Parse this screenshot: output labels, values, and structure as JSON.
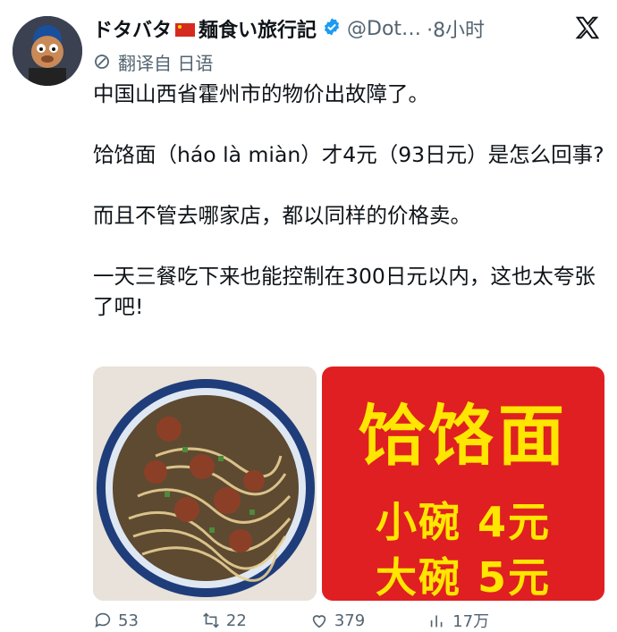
{
  "tweet": {
    "author_name": "ドタバタ",
    "author_name_suffix": "麺食い旅行記",
    "handle": "@Dot…",
    "separator": "·",
    "time": "8小时",
    "translate_label": "翻译自 日语",
    "paragraphs": [
      "中国山西省霍州市的物价出故障了。",
      "饸饹面（háo là miàn）才4元（93日元）是怎么回事?",
      "而且不管去哪家店，都以同样的价格卖。",
      "一天三餐吃下来也能控制在300日元以内，这也太夸张了吧!"
    ],
    "sign": {
      "title": "饸饹面",
      "small": "小碗 4元",
      "large": "大碗 5元"
    },
    "actions": {
      "replies": "53",
      "retweets": "22",
      "likes": "379",
      "views": "17万"
    }
  },
  "colors": {
    "text": "#0f1419",
    "muted": "#536471",
    "verified": "#1d9bf0",
    "sign_bg": "#e01f22",
    "sign_text": "#ffe600"
  }
}
